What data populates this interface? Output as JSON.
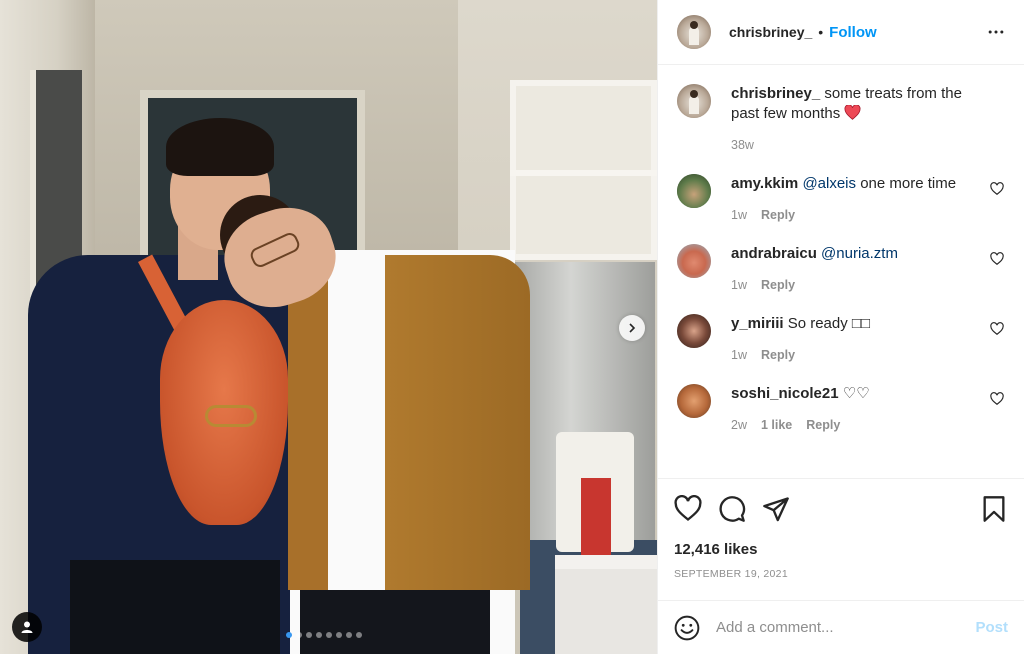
{
  "post": {
    "author": "chrisbriney_",
    "separator": "•",
    "follow_label": "Follow",
    "more_icon": "more-horizontal-icon",
    "carousel": {
      "slide_count": 8,
      "active_index": 0
    }
  },
  "caption": {
    "username": "chrisbriney_",
    "text": "some treats from the past few months",
    "emoji": "red-heart",
    "time": "38w"
  },
  "comments": [
    {
      "username": "amy.kkim",
      "mention": "@alxeis",
      "text": "one more time",
      "time": "1w",
      "likes": "",
      "reply": "Reply"
    },
    {
      "username": "andrabraicu",
      "mention": "@nuria.ztm",
      "text": "",
      "time": "1w",
      "likes": "",
      "reply": "Reply"
    },
    {
      "username": "y_miriii",
      "mention": "",
      "text": "So ready □□",
      "time": "1w",
      "likes": "",
      "reply": "Reply"
    },
    {
      "username": "soshi_nicole21",
      "mention": "",
      "text": "♡♡",
      "time": "2w",
      "likes": "1 like",
      "reply": "Reply"
    }
  ],
  "actions": {
    "likes": "12,416 likes",
    "date": "SEPTEMBER 19, 2021"
  },
  "add_comment": {
    "placeholder": "Add a comment...",
    "post_label": "Post"
  },
  "colors": {
    "link_blue": "#0095f6",
    "mention_blue": "#00376b",
    "muted": "#8e8e8e",
    "post_disabled": "#b2dffc",
    "heart_red": "#ed4956"
  }
}
